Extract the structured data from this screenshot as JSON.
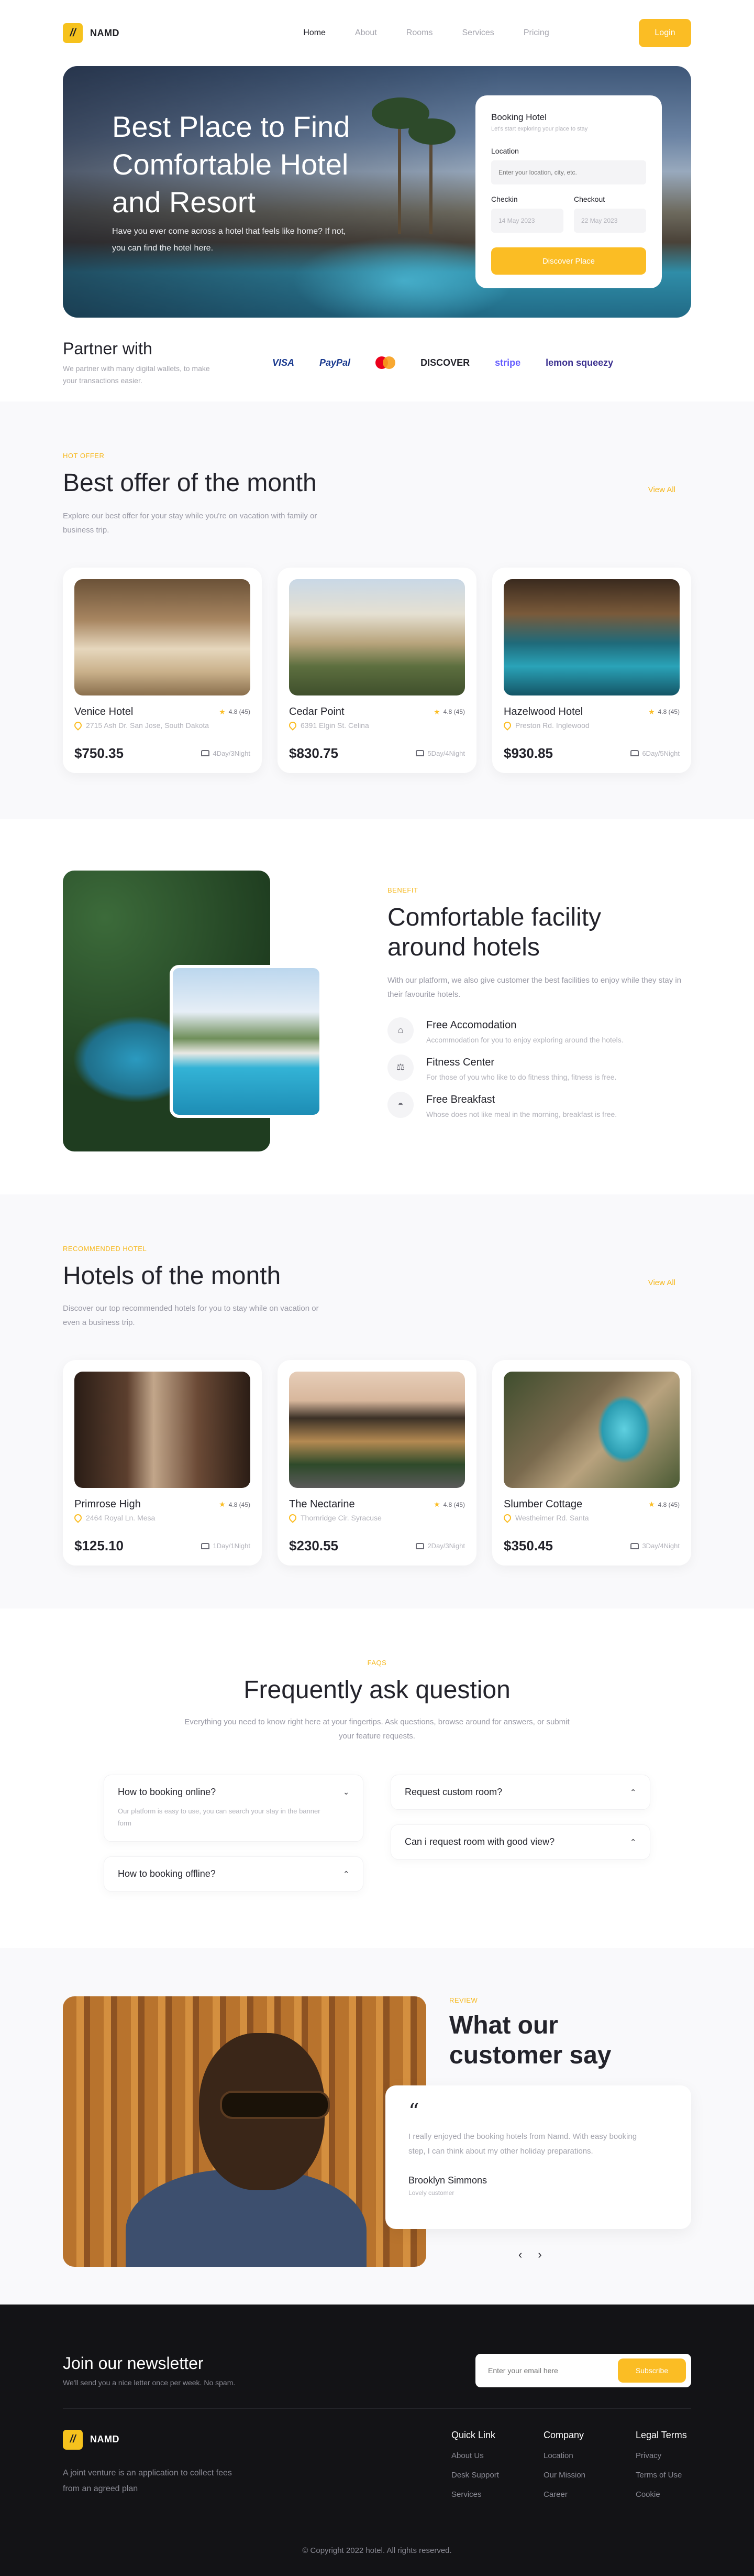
{
  "brand": {
    "name": "NAMD",
    "mark": "//"
  },
  "nav": {
    "links": [
      "Home",
      "About",
      "Rooms",
      "Services",
      "Pricing"
    ],
    "login": "Login"
  },
  "hero": {
    "title": "Best Place to Find Comfortable Hotel and Resort",
    "subtitle": "Have you ever come across a hotel that feels like home? If not, you can find the hotel here.",
    "booking": {
      "title": "Booking Hotel",
      "note": "Let's start exploring your place to stay",
      "location_label": "Location",
      "location_placeholder": "Enter your location, city, etc.",
      "checkin_label": "Checkin",
      "checkin_value": "14 May 2023",
      "checkout_label": "Checkout",
      "checkout_value": "22 May 2023",
      "button": "Discover Place"
    }
  },
  "partner": {
    "title": "Partner with",
    "desc": "We partner with many digital wallets, to make your transactions easier.",
    "logos": [
      "VISA",
      "PayPal",
      "mastercard",
      "DISCOVER",
      "stripe",
      "lemon squeezy"
    ]
  },
  "offer": {
    "label": "HOT OFFER",
    "title": "Best offer of the month",
    "desc": "Explore our best offer for your stay while you're on vacation with family or business trip.",
    "view_all": "View All",
    "cards": [
      {
        "name": "Venice Hotel",
        "rating": "4.8 (45)",
        "address": "2715 Ash Dr. San Jose, South Dakota",
        "price": "$750.35",
        "stay": "4Day/3Night"
      },
      {
        "name": "Cedar Point",
        "rating": "4.8 (45)",
        "address": "6391 Elgin St. Celina",
        "price": "$830.75",
        "stay": "5Day/4Night"
      },
      {
        "name": "Hazelwood Hotel",
        "rating": "4.8 (45)",
        "address": "Preston Rd. Inglewood",
        "price": "$930.85",
        "stay": "6Day/5Night"
      }
    ]
  },
  "facility": {
    "label": "BENEFIT",
    "title": "Comfortable facility around hotels",
    "desc": "With our platform, we also give customer the best facilities to enjoy while they stay in their favourite hotels.",
    "items": [
      {
        "title": "Free Accomodation",
        "desc": "Accommodation for you to enjoy exploring around the hotels."
      },
      {
        "title": "Fitness Center",
        "desc": "For those of you who like to do fitness thing, fitness is free."
      },
      {
        "title": "Free Breakfast",
        "desc": "Whose does not like meal in the morning, breakfast is free."
      }
    ]
  },
  "hotels": {
    "label": "RECOMMENDED HOTEL",
    "title": "Hotels of the month",
    "desc": "Discover our top recommended hotels for you to stay while on vacation or even a business trip.",
    "view_all": "View All",
    "cards": [
      {
        "name": "Primrose High",
        "rating": "4.8 (45)",
        "address": "2464 Royal Ln. Mesa",
        "price": "$125.10",
        "stay": "1Day/1Night"
      },
      {
        "name": "The Nectarine",
        "rating": "4.8 (45)",
        "address": "Thornridge Cir. Syracuse",
        "price": "$230.55",
        "stay": "2Day/3Night"
      },
      {
        "name": "Slumber Cottage",
        "rating": "4.8 (45)",
        "address": "Westheimer Rd. Santa",
        "price": "$350.45",
        "stay": "3Day/4Night"
      }
    ]
  },
  "faq": {
    "label": "FAQS",
    "title": "Frequently ask question",
    "desc": "Everything you need to know right here at your fingertips. Ask questions, browse around for answers, or submit your feature requests.",
    "items_left": [
      {
        "q": "How to booking online?",
        "a": "Our platform is easy to use, you can search your stay in the banner form"
      },
      {
        "q": "How to booking offline?",
        "a": ""
      }
    ],
    "items_right": [
      {
        "q": "Request custom room?",
        "a": ""
      },
      {
        "q": "Can i request room with good view?",
        "a": ""
      }
    ]
  },
  "review": {
    "label": "REVIEW",
    "title": "What our customer say",
    "quote": "I really enjoyed the booking hotels from Namd. With easy booking step, I can think about my other holiday preparations.",
    "name": "Brooklyn Simmons",
    "role": "Lovely customer"
  },
  "footer": {
    "news_title": "Join our newsletter",
    "news_desc": "We'll send you a nice letter once per week. No spam.",
    "email_placeholder": "Enter your email here",
    "subscribe": "Subscribe",
    "about": "A joint venture is an application to collect fees from an agreed plan",
    "cols": [
      {
        "title": "Quick Link",
        "links": [
          "About Us",
          "Desk Support",
          "Services"
        ]
      },
      {
        "title": "Company",
        "links": [
          "Location",
          "Our Mission",
          "Career"
        ]
      },
      {
        "title": "Legal Terms",
        "links": [
          "Privacy",
          "Terms of Use",
          "Cookie"
        ]
      }
    ],
    "copyright": "© Copyright 2022 hotel. All rights reserved."
  },
  "colors": {
    "accent": "#fbbd24",
    "dark": "#131316"
  },
  "icons": [
    "pin-icon",
    "star-icon",
    "bed-icon",
    "chevron-down-icon",
    "chevron-up-icon",
    "quote-icon",
    "arrow-left-icon",
    "arrow-right-icon"
  ]
}
